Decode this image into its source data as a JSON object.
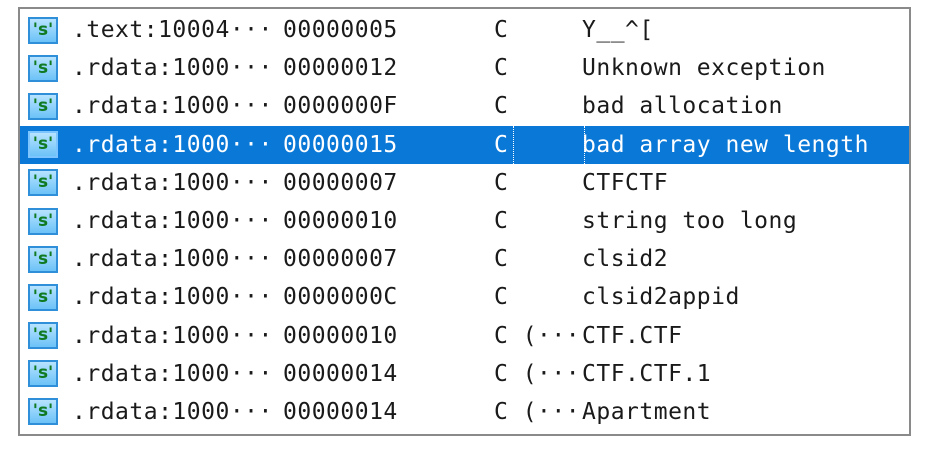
{
  "icon": "string-literal-icon",
  "icon_glyph": "'s'",
  "selected_row_index": 3,
  "colors": {
    "selection": "#0a78d7",
    "icon_border": "#2f8fd8",
    "icon_fill": "#6cc2f7",
    "icon_glyph": "#0f7a21"
  },
  "rows": [
    {
      "address": ".text:10004···",
      "length": "00000005",
      "type": "C",
      "value": "Y__^["
    },
    {
      "address": ".rdata:1000···",
      "length": "00000012",
      "type": "C",
      "value": "Unknown exception"
    },
    {
      "address": ".rdata:1000···",
      "length": "0000000F",
      "type": "C",
      "value": "bad allocation"
    },
    {
      "address": ".rdata:1000···",
      "length": "00000015",
      "type": "C",
      "value": "bad array new length"
    },
    {
      "address": ".rdata:1000···",
      "length": "00000007",
      "type": "C",
      "value": "CTFCTF"
    },
    {
      "address": ".rdata:1000···",
      "length": "00000010",
      "type": "C",
      "value": "string too long"
    },
    {
      "address": ".rdata:1000···",
      "length": "00000007",
      "type": "C",
      "value": "clsid2"
    },
    {
      "address": ".rdata:1000···",
      "length": "0000000C",
      "type": "C",
      "value": "clsid2appid"
    },
    {
      "address": ".rdata:1000···",
      "length": "00000010",
      "type": "C (···",
      "value": "CTF.CTF"
    },
    {
      "address": ".rdata:1000···",
      "length": "00000014",
      "type": "C (···",
      "value": "CTF.CTF.1"
    },
    {
      "address": ".rdata:1000···",
      "length": "00000014",
      "type": "C (···",
      "value": "Apartment"
    }
  ]
}
